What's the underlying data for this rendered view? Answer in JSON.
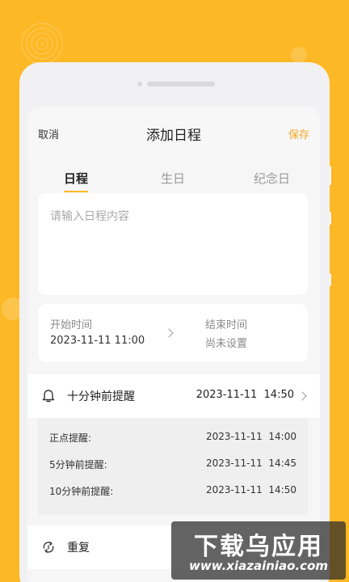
{
  "header": {
    "cancel_label": "取消",
    "title": "添加日程",
    "save_label": "保存"
  },
  "tabs": [
    {
      "label": "日程",
      "active": true
    },
    {
      "label": "生日",
      "active": false
    },
    {
      "label": "纪念日",
      "active": false
    }
  ],
  "content_input": {
    "placeholder": "请输入日程内容"
  },
  "time": {
    "start_label": "开始时间",
    "start_value": "2023-11-11 11:00",
    "end_label": "结束时间",
    "end_value": "尚未设置"
  },
  "reminder": {
    "label": "十分钟前提醒",
    "date": "2023-11-11",
    "time": "14:50",
    "options": [
      {
        "label": "正点提醒:",
        "date": "2023-11-11",
        "time": "14:00"
      },
      {
        "label": "5分钟前提醒:",
        "date": "2023-11-11",
        "time": "14:45"
      },
      {
        "label": "10分钟前提醒:",
        "date": "2023-11-11",
        "time": "14:50"
      }
    ]
  },
  "repeat": {
    "label": "重复"
  },
  "watermark": {
    "main": "下载乌应用",
    "url": "www.xiazainiao.com"
  },
  "colors": {
    "background": "#FDB825",
    "accent": "#F5A623"
  },
  "icons": [
    "bell-icon",
    "repeat-icon",
    "chevron-right-icon"
  ]
}
